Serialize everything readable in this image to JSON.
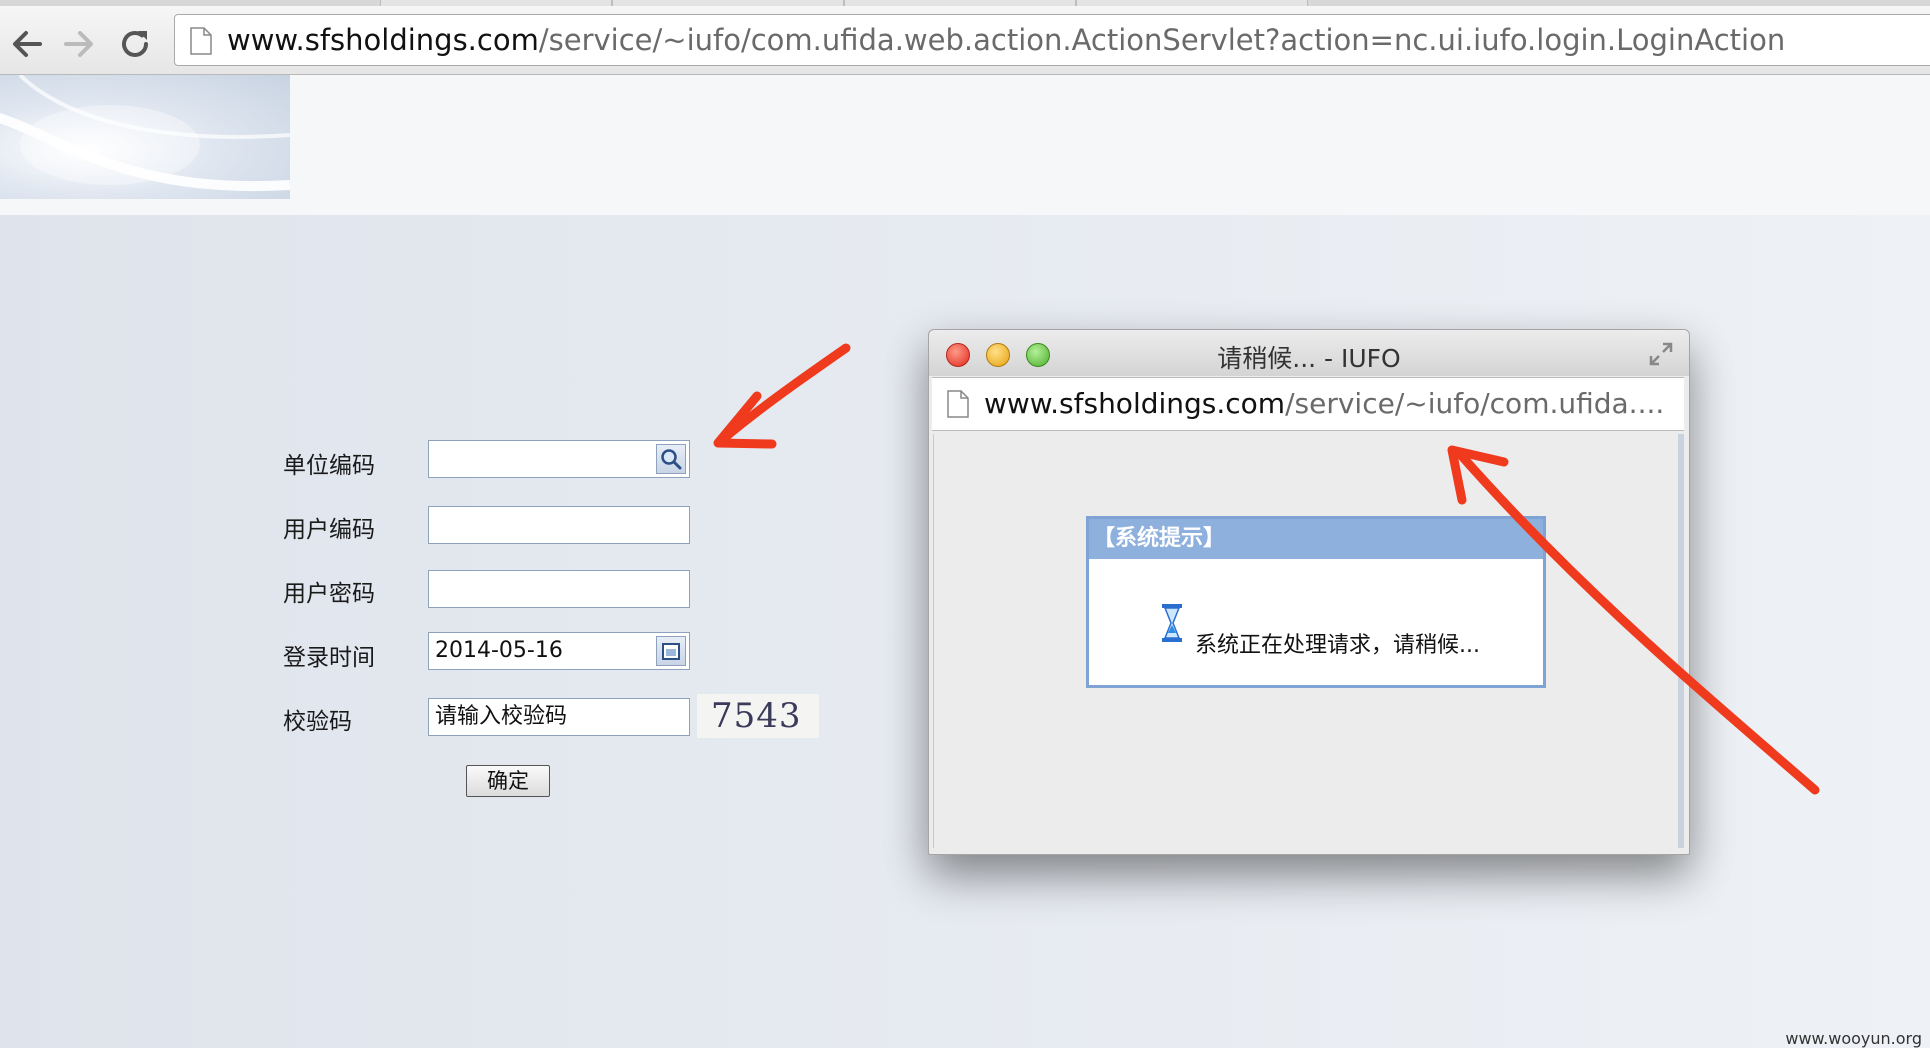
{
  "browser": {
    "url_host": "www.sfsholdings.com",
    "url_path": "/service/~iufo/com.ufida.web.action.ActionServlet?action=nc.ui.iufo.login.LoginAction",
    "icons": [
      "back-arrow-icon",
      "forward-arrow-icon",
      "reload-icon",
      "page-icon"
    ]
  },
  "login_form": {
    "unit_code_label": "单位编码",
    "user_code_label": "用户编码",
    "password_label": "用户密码",
    "login_time_label": "登录时间",
    "login_time_value": "2014-05-16",
    "captcha_label": "校验码",
    "captcha_placeholder": "请输入校验码",
    "captcha_text": "7543",
    "confirm_label": "确定"
  },
  "popup": {
    "title": "请稍候... - IUFO",
    "url_host": "www.sfsholdings.com",
    "url_path": "/service/~iufo/com.ufida....",
    "dialog_title": "【系统提示】",
    "dialog_message": "系统正在处理请求，请稍候..."
  },
  "annotation_color": "#f03a1e",
  "watermark": "www.wooyun.org"
}
